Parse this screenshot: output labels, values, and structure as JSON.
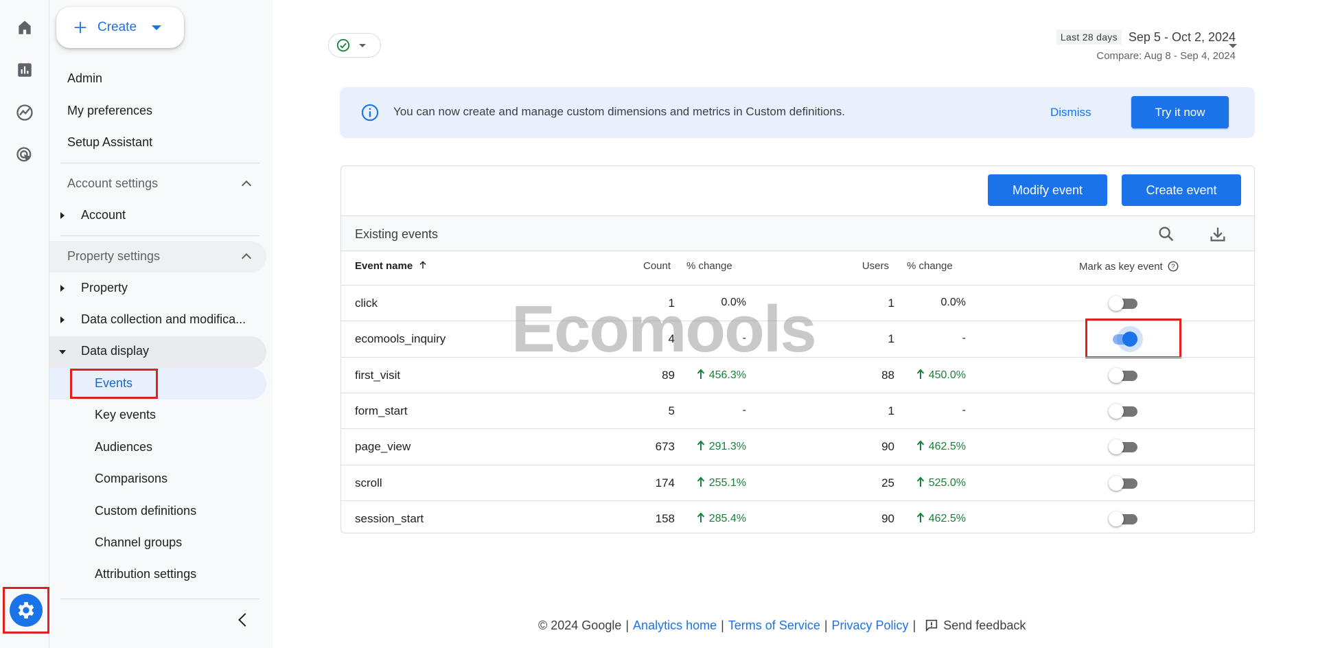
{
  "rail": {
    "icons": [
      "home-icon",
      "reports-icon",
      "explore-icon",
      "advertising-icon"
    ],
    "settings_icon": "gear-icon"
  },
  "sidebar": {
    "create_label": "Create",
    "top_items": [
      "Admin",
      "My preferences",
      "Setup Assistant"
    ],
    "account_settings": {
      "label": "Account settings",
      "items": [
        "Account"
      ]
    },
    "property_settings": {
      "label": "Property settings",
      "items": [
        "Property",
        "Data collection and modifica..."
      ],
      "data_display": {
        "label": "Data display",
        "items": [
          "Events",
          "Key events",
          "Audiences",
          "Comparisons",
          "Custom definitions",
          "Channel groups",
          "Attribution settings"
        ]
      }
    }
  },
  "header": {
    "date_chip": "Last 28 days",
    "date_range": "Sep 5 - Oct 2, 2024",
    "compare": "Compare: Aug 8 - Sep 4, 2024"
  },
  "banner": {
    "text": "You can now create and manage custom dimensions and metrics in Custom definitions.",
    "dismiss": "Dismiss",
    "try": "Try it now"
  },
  "card": {
    "modify_label": "Modify event",
    "create_label": "Create event",
    "existing_title": "Existing events",
    "columns": {
      "event_name": "Event name",
      "count": "Count",
      "count_change": "% change",
      "users": "Users",
      "users_change": "% change",
      "key_event": "Mark as key event"
    },
    "rows": [
      {
        "name": "click",
        "count": "1",
        "count_change": "0.0%",
        "count_up": false,
        "users": "1",
        "users_change": "0.0%",
        "users_up": false,
        "key": false
      },
      {
        "name": "ecomools_inquiry",
        "count": "4",
        "count_change": "-",
        "count_up": false,
        "users": "1",
        "users_change": "-",
        "users_up": false,
        "key": true
      },
      {
        "name": "first_visit",
        "count": "89",
        "count_change": "456.3%",
        "count_up": true,
        "users": "88",
        "users_change": "450.0%",
        "users_up": true,
        "key": false
      },
      {
        "name": "form_start",
        "count": "5",
        "count_change": "-",
        "count_up": false,
        "users": "1",
        "users_change": "-",
        "users_up": false,
        "key": false
      },
      {
        "name": "page_view",
        "count": "673",
        "count_change": "291.3%",
        "count_up": true,
        "users": "90",
        "users_change": "462.5%",
        "users_up": true,
        "key": false
      },
      {
        "name": "scroll",
        "count": "174",
        "count_change": "255.1%",
        "count_up": true,
        "users": "25",
        "users_change": "525.0%",
        "users_up": true,
        "key": false
      },
      {
        "name": "session_start",
        "count": "158",
        "count_change": "285.4%",
        "count_up": true,
        "users": "90",
        "users_change": "462.5%",
        "users_up": true,
        "key": false
      }
    ]
  },
  "watermark": "Ecomools",
  "footer": {
    "copyright": "© 2024 Google",
    "links": [
      "Analytics home",
      "Terms of Service",
      "Privacy Policy"
    ],
    "feedback": "Send feedback"
  },
  "colors": {
    "accent": "#1a73e8",
    "positive": "#188038",
    "highlight": "#e0201c"
  }
}
